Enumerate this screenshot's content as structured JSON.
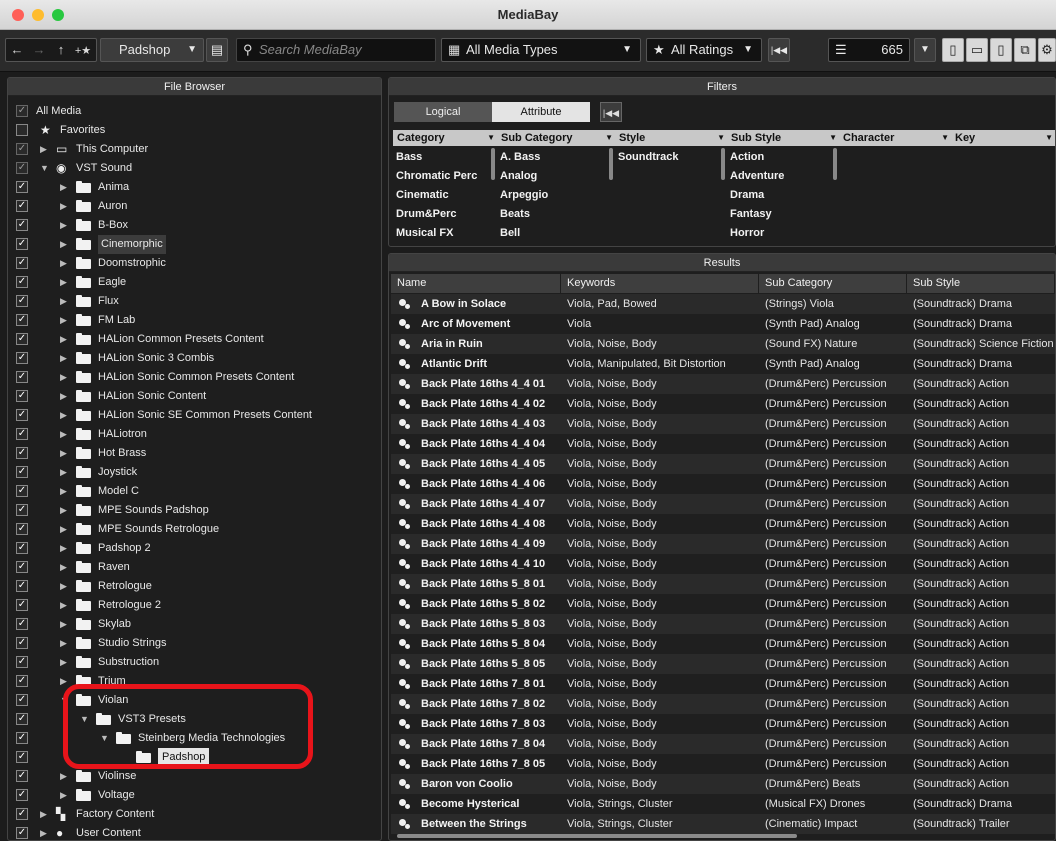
{
  "window": {
    "title": "MediaBay"
  },
  "toolbar": {
    "back": "←",
    "forward": "→",
    "up": "↑",
    "favorite_star": "+★",
    "location": "Padshop",
    "search_placeholder": "Search MediaBay",
    "media_types": "All Media Types",
    "ratings": "All Ratings",
    "result_count": "665"
  },
  "file_browser": {
    "title": "File Browser",
    "items": [
      {
        "label": "All Media",
        "check": "✓"
      },
      {
        "label": "Favorites",
        "check": ""
      },
      {
        "label": "This Computer",
        "check": "✓"
      },
      {
        "label": "VST Sound",
        "check": "✓"
      },
      {
        "label": "Anima",
        "check": "✓"
      },
      {
        "label": "Auron",
        "check": "✓"
      },
      {
        "label": "B-Box",
        "check": "✓"
      },
      {
        "label": "Cinemorphic",
        "check": "✓"
      },
      {
        "label": "Doomstrophic",
        "check": "✓"
      },
      {
        "label": "Eagle",
        "check": "✓"
      },
      {
        "label": "Flux",
        "check": "✓"
      },
      {
        "label": "FM Lab",
        "check": "✓"
      },
      {
        "label": "HALion Common Presets Content",
        "check": "✓"
      },
      {
        "label": "HALion Sonic 3 Combis",
        "check": "✓"
      },
      {
        "label": "HALion Sonic Common Presets Content",
        "check": "✓"
      },
      {
        "label": "HALion Sonic Content",
        "check": "✓"
      },
      {
        "label": "HALion Sonic SE Common Presets Content",
        "check": "✓"
      },
      {
        "label": "HALiotron",
        "check": "✓"
      },
      {
        "label": "Hot Brass",
        "check": "✓"
      },
      {
        "label": "Joystick",
        "check": "✓"
      },
      {
        "label": "Model C",
        "check": "✓"
      },
      {
        "label": "MPE Sounds Padshop",
        "check": "✓"
      },
      {
        "label": "MPE Sounds Retrologue",
        "check": "✓"
      },
      {
        "label": "Padshop 2",
        "check": "✓"
      },
      {
        "label": "Raven",
        "check": "✓"
      },
      {
        "label": "Retrologue",
        "check": "✓"
      },
      {
        "label": "Retrologue 2",
        "check": "✓"
      },
      {
        "label": "Skylab",
        "check": "✓"
      },
      {
        "label": "Studio Strings",
        "check": "✓"
      },
      {
        "label": "Substruction",
        "check": "✓"
      },
      {
        "label": "Trium",
        "check": "✓"
      },
      {
        "label": "Violan",
        "check": "✓"
      },
      {
        "label": "VST3 Presets",
        "check": "✓"
      },
      {
        "label": "Steinberg Media Technologies",
        "check": "✓"
      },
      {
        "label": "Padshop",
        "check": "✓"
      },
      {
        "label": "Violinse",
        "check": "✓"
      },
      {
        "label": "Voltage",
        "check": "✓"
      },
      {
        "label": "Factory Content",
        "check": "✓"
      },
      {
        "label": "User Content",
        "check": "✓"
      }
    ]
  },
  "filters": {
    "title": "Filters",
    "tab_logical": "Logical",
    "tab_attribute": "Attribute",
    "columns": [
      {
        "header": "Category",
        "values": [
          "Bass",
          "Chromatic Perc",
          "Cinematic",
          "Drum&Perc",
          "Musical FX"
        ]
      },
      {
        "header": "Sub Category",
        "values": [
          "A. Bass",
          "Analog",
          "Arpeggio",
          "Beats",
          "Bell"
        ]
      },
      {
        "header": "Style",
        "values": [
          "Soundtrack"
        ]
      },
      {
        "header": "Sub Style",
        "values": [
          "Action",
          "Adventure",
          "Drama",
          "Fantasy",
          "Horror"
        ]
      },
      {
        "header": "Character",
        "values": []
      },
      {
        "header": "Key",
        "values": []
      }
    ]
  },
  "results": {
    "title": "Results",
    "headers": [
      "Name",
      "Keywords",
      "Sub Category",
      "Sub Style"
    ],
    "rows": [
      [
        "A Bow in Solace",
        "Viola, Pad, Bowed",
        "(Strings) Viola",
        "(Soundtrack) Drama"
      ],
      [
        "Arc of Movement",
        "Viola",
        "(Synth Pad) Analog",
        "(Soundtrack) Drama"
      ],
      [
        "Aria in Ruin",
        "Viola, Noise, Body",
        "(Sound FX) Nature",
        "(Soundtrack) Science Fiction"
      ],
      [
        "Atlantic Drift",
        "Viola, Manipulated, Bit Distortion",
        "(Synth Pad) Analog",
        "(Soundtrack) Drama"
      ],
      [
        "Back Plate 16ths 4_4 01",
        "Viola, Noise, Body",
        "(Drum&Perc) Percussion",
        "(Soundtrack) Action"
      ],
      [
        "Back Plate 16ths 4_4 02",
        "Viola, Noise, Body",
        "(Drum&Perc) Percussion",
        "(Soundtrack) Action"
      ],
      [
        "Back Plate 16ths 4_4 03",
        "Viola, Noise, Body",
        "(Drum&Perc) Percussion",
        "(Soundtrack) Action"
      ],
      [
        "Back Plate 16ths 4_4 04",
        "Viola, Noise, Body",
        "(Drum&Perc) Percussion",
        "(Soundtrack) Action"
      ],
      [
        "Back Plate 16ths 4_4 05",
        "Viola, Noise, Body",
        "(Drum&Perc) Percussion",
        "(Soundtrack) Action"
      ],
      [
        "Back Plate 16ths 4_4 06",
        "Viola, Noise, Body",
        "(Drum&Perc) Percussion",
        "(Soundtrack) Action"
      ],
      [
        "Back Plate 16ths 4_4 07",
        "Viola, Noise, Body",
        "(Drum&Perc) Percussion",
        "(Soundtrack) Action"
      ],
      [
        "Back Plate 16ths 4_4 08",
        "Viola, Noise, Body",
        "(Drum&Perc) Percussion",
        "(Soundtrack) Action"
      ],
      [
        "Back Plate 16ths 4_4 09",
        "Viola, Noise, Body",
        "(Drum&Perc) Percussion",
        "(Soundtrack) Action"
      ],
      [
        "Back Plate 16ths 4_4 10",
        "Viola, Noise, Body",
        "(Drum&Perc) Percussion",
        "(Soundtrack) Action"
      ],
      [
        "Back Plate 16ths 5_8 01",
        "Viola, Noise, Body",
        "(Drum&Perc) Percussion",
        "(Soundtrack) Action"
      ],
      [
        "Back Plate 16ths 5_8 02",
        "Viola, Noise, Body",
        "(Drum&Perc) Percussion",
        "(Soundtrack) Action"
      ],
      [
        "Back Plate 16ths 5_8 03",
        "Viola, Noise, Body",
        "(Drum&Perc) Percussion",
        "(Soundtrack) Action"
      ],
      [
        "Back Plate 16ths 5_8 04",
        "Viola, Noise, Body",
        "(Drum&Perc) Percussion",
        "(Soundtrack) Action"
      ],
      [
        "Back Plate 16ths 5_8 05",
        "Viola, Noise, Body",
        "(Drum&Perc) Percussion",
        "(Soundtrack) Action"
      ],
      [
        "Back Plate 16ths 7_8 01",
        "Viola, Noise, Body",
        "(Drum&Perc) Percussion",
        "(Soundtrack) Action"
      ],
      [
        "Back Plate 16ths 7_8 02",
        "Viola, Noise, Body",
        "(Drum&Perc) Percussion",
        "(Soundtrack) Action"
      ],
      [
        "Back Plate 16ths 7_8 03",
        "Viola, Noise, Body",
        "(Drum&Perc) Percussion",
        "(Soundtrack) Action"
      ],
      [
        "Back Plate 16ths 7_8 04",
        "Viola, Noise, Body",
        "(Drum&Perc) Percussion",
        "(Soundtrack) Action"
      ],
      [
        "Back Plate 16ths 7_8 05",
        "Viola, Noise, Body",
        "(Drum&Perc) Percussion",
        "(Soundtrack) Action"
      ],
      [
        "Baron von Coolio",
        "Viola, Noise, Body",
        "(Drum&Perc) Beats",
        "(Soundtrack) Action"
      ],
      [
        "Become Hysterical",
        "Viola, Strings, Cluster",
        "(Musical FX) Drones",
        "(Soundtrack) Drama"
      ],
      [
        "Between the Strings",
        "Viola, Strings, Cluster",
        "(Cinematic) Impact",
        "(Soundtrack) Trailer"
      ]
    ]
  },
  "colors": {
    "highlight": "#e8141a",
    "background": "#1c1c1c"
  }
}
